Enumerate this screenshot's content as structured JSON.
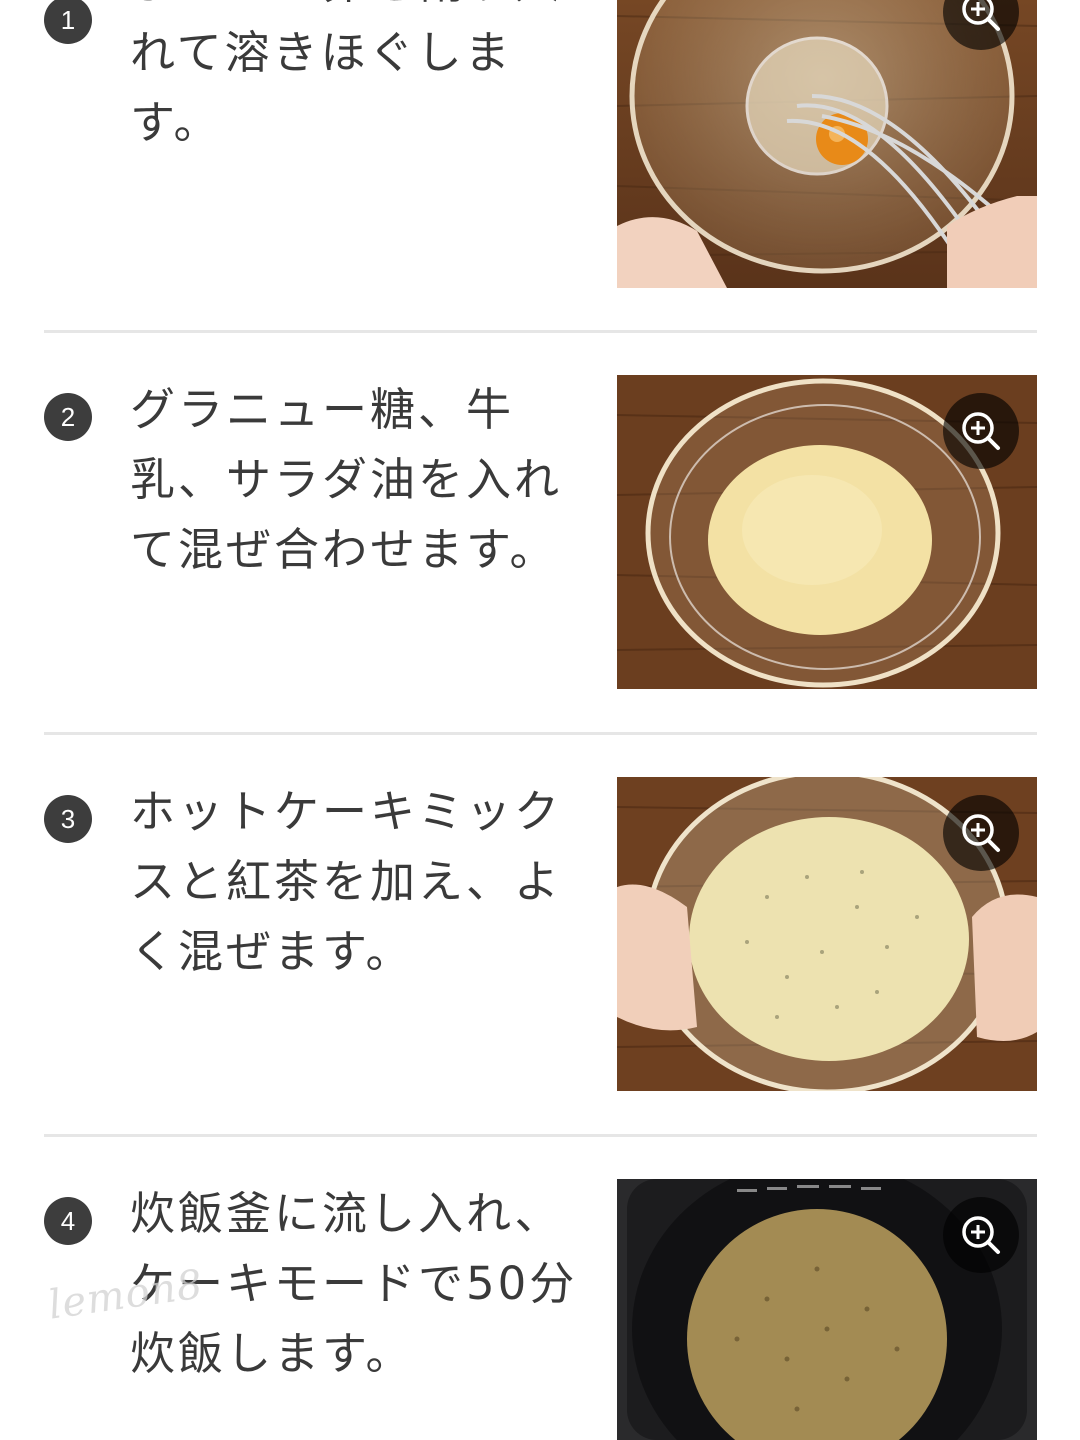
{
  "steps": [
    {
      "number": "1",
      "text": "ボウルに卵を割り入れて溶きほぐします。",
      "photo_icon": "bowl-egg-whisk-photo",
      "zoom_icon": "zoom-in-icon"
    },
    {
      "number": "2",
      "text": "グラニュー糖、牛乳、サラダ油を入れて混ぜ合わせます。",
      "photo_icon": "bowl-batter-photo",
      "zoom_icon": "zoom-in-icon"
    },
    {
      "number": "3",
      "text": "ホットケーキミックスと紅茶を加え、よく混ぜます。",
      "photo_icon": "bowl-tea-batter-photo",
      "zoom_icon": "zoom-in-icon"
    },
    {
      "number": "4",
      "text": "炊飯釜に流し入れ、ケーキモードで50分炊飯します。",
      "photo_icon": "rice-cooker-cake-photo",
      "zoom_icon": "zoom-in-icon"
    }
  ],
  "watermark": "lemon8",
  "colors": {
    "badge": "#3d3d3d",
    "text": "#3a3a3a",
    "divider": "#e6e6e6",
    "wood": "#6b4023"
  }
}
